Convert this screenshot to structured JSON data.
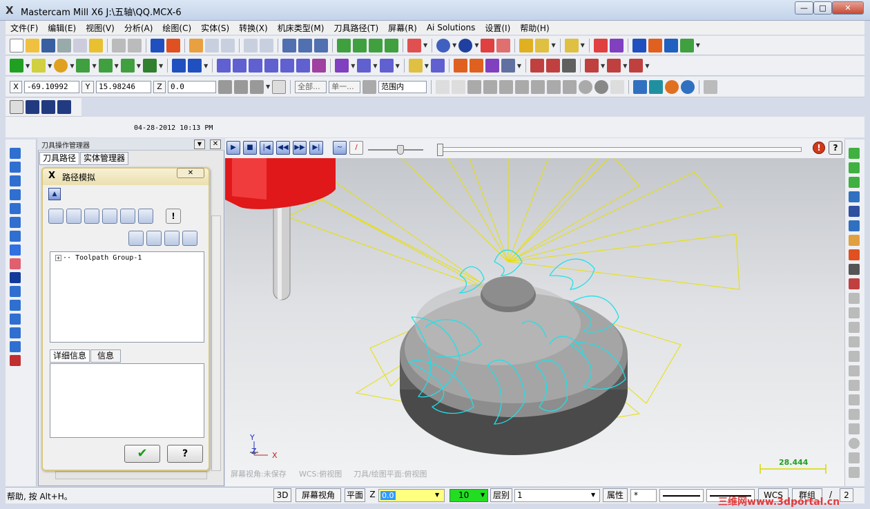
{
  "window": {
    "title": "Mastercam Mill X6  J:\\五轴\\QQ.MCX-6",
    "app_icon": "mastercam-logo-icon"
  },
  "menu": [
    "文件(F)",
    "编辑(E)",
    "视图(V)",
    "分析(A)",
    "绘图(C)",
    "实体(S)",
    "转换(X)",
    "机床类型(M)",
    "刀具路径(T)",
    "屏幕(R)",
    "Ai Solutions",
    "设置(I)",
    "帮助(H)"
  ],
  "coords": {
    "x_label": "X",
    "x_value": "-69.10992",
    "y_label": "Y",
    "y_value": "15.98246",
    "z_label": "Z",
    "z_value": "0.0"
  },
  "selection": {
    "all": "全部...",
    "single": "单一...",
    "range": "范围内"
  },
  "date": "04-28-2012 10:13 PM",
  "manager": {
    "title": "刀具操作管理器",
    "tabs": [
      "刀具路径",
      "实体管理器"
    ]
  },
  "sim_dialog": {
    "title": "路径模拟",
    "tree_item": "Toolpath Group-1",
    "tabs": [
      "详细信息",
      "信息"
    ]
  },
  "viewport": {
    "axis_y": "Y",
    "axis_z": "Z",
    "axis_x": "X",
    "info_view": "屏幕视角:未保存",
    "info_wcs": "WCS:俯视图",
    "info_plane": "刀具/绘图平面:俯视图",
    "scale_value": "28.444"
  },
  "status": {
    "help": "帮助, 按 Alt+H。",
    "btn_3d": "3D",
    "btn_view": "屏幕视角",
    "btn_plane": "平面",
    "z_label": "Z",
    "z_value": "0.0",
    "color_value": "10",
    "level_label": "层别",
    "level_value": "1",
    "attr_label": "属性",
    "star": "*",
    "wcs": "WCS",
    "group": "群组",
    "slash": "/",
    "two": "2"
  },
  "watermark": "三维网www.3dportal.cn",
  "colors": {
    "toolpath": "#1fe0e8",
    "stock": "#8b8b8b",
    "tool_holder": "#e0181a",
    "fan_lines": "#e8e000",
    "z_field": "#ffff80",
    "color_field": "#22dd22"
  }
}
